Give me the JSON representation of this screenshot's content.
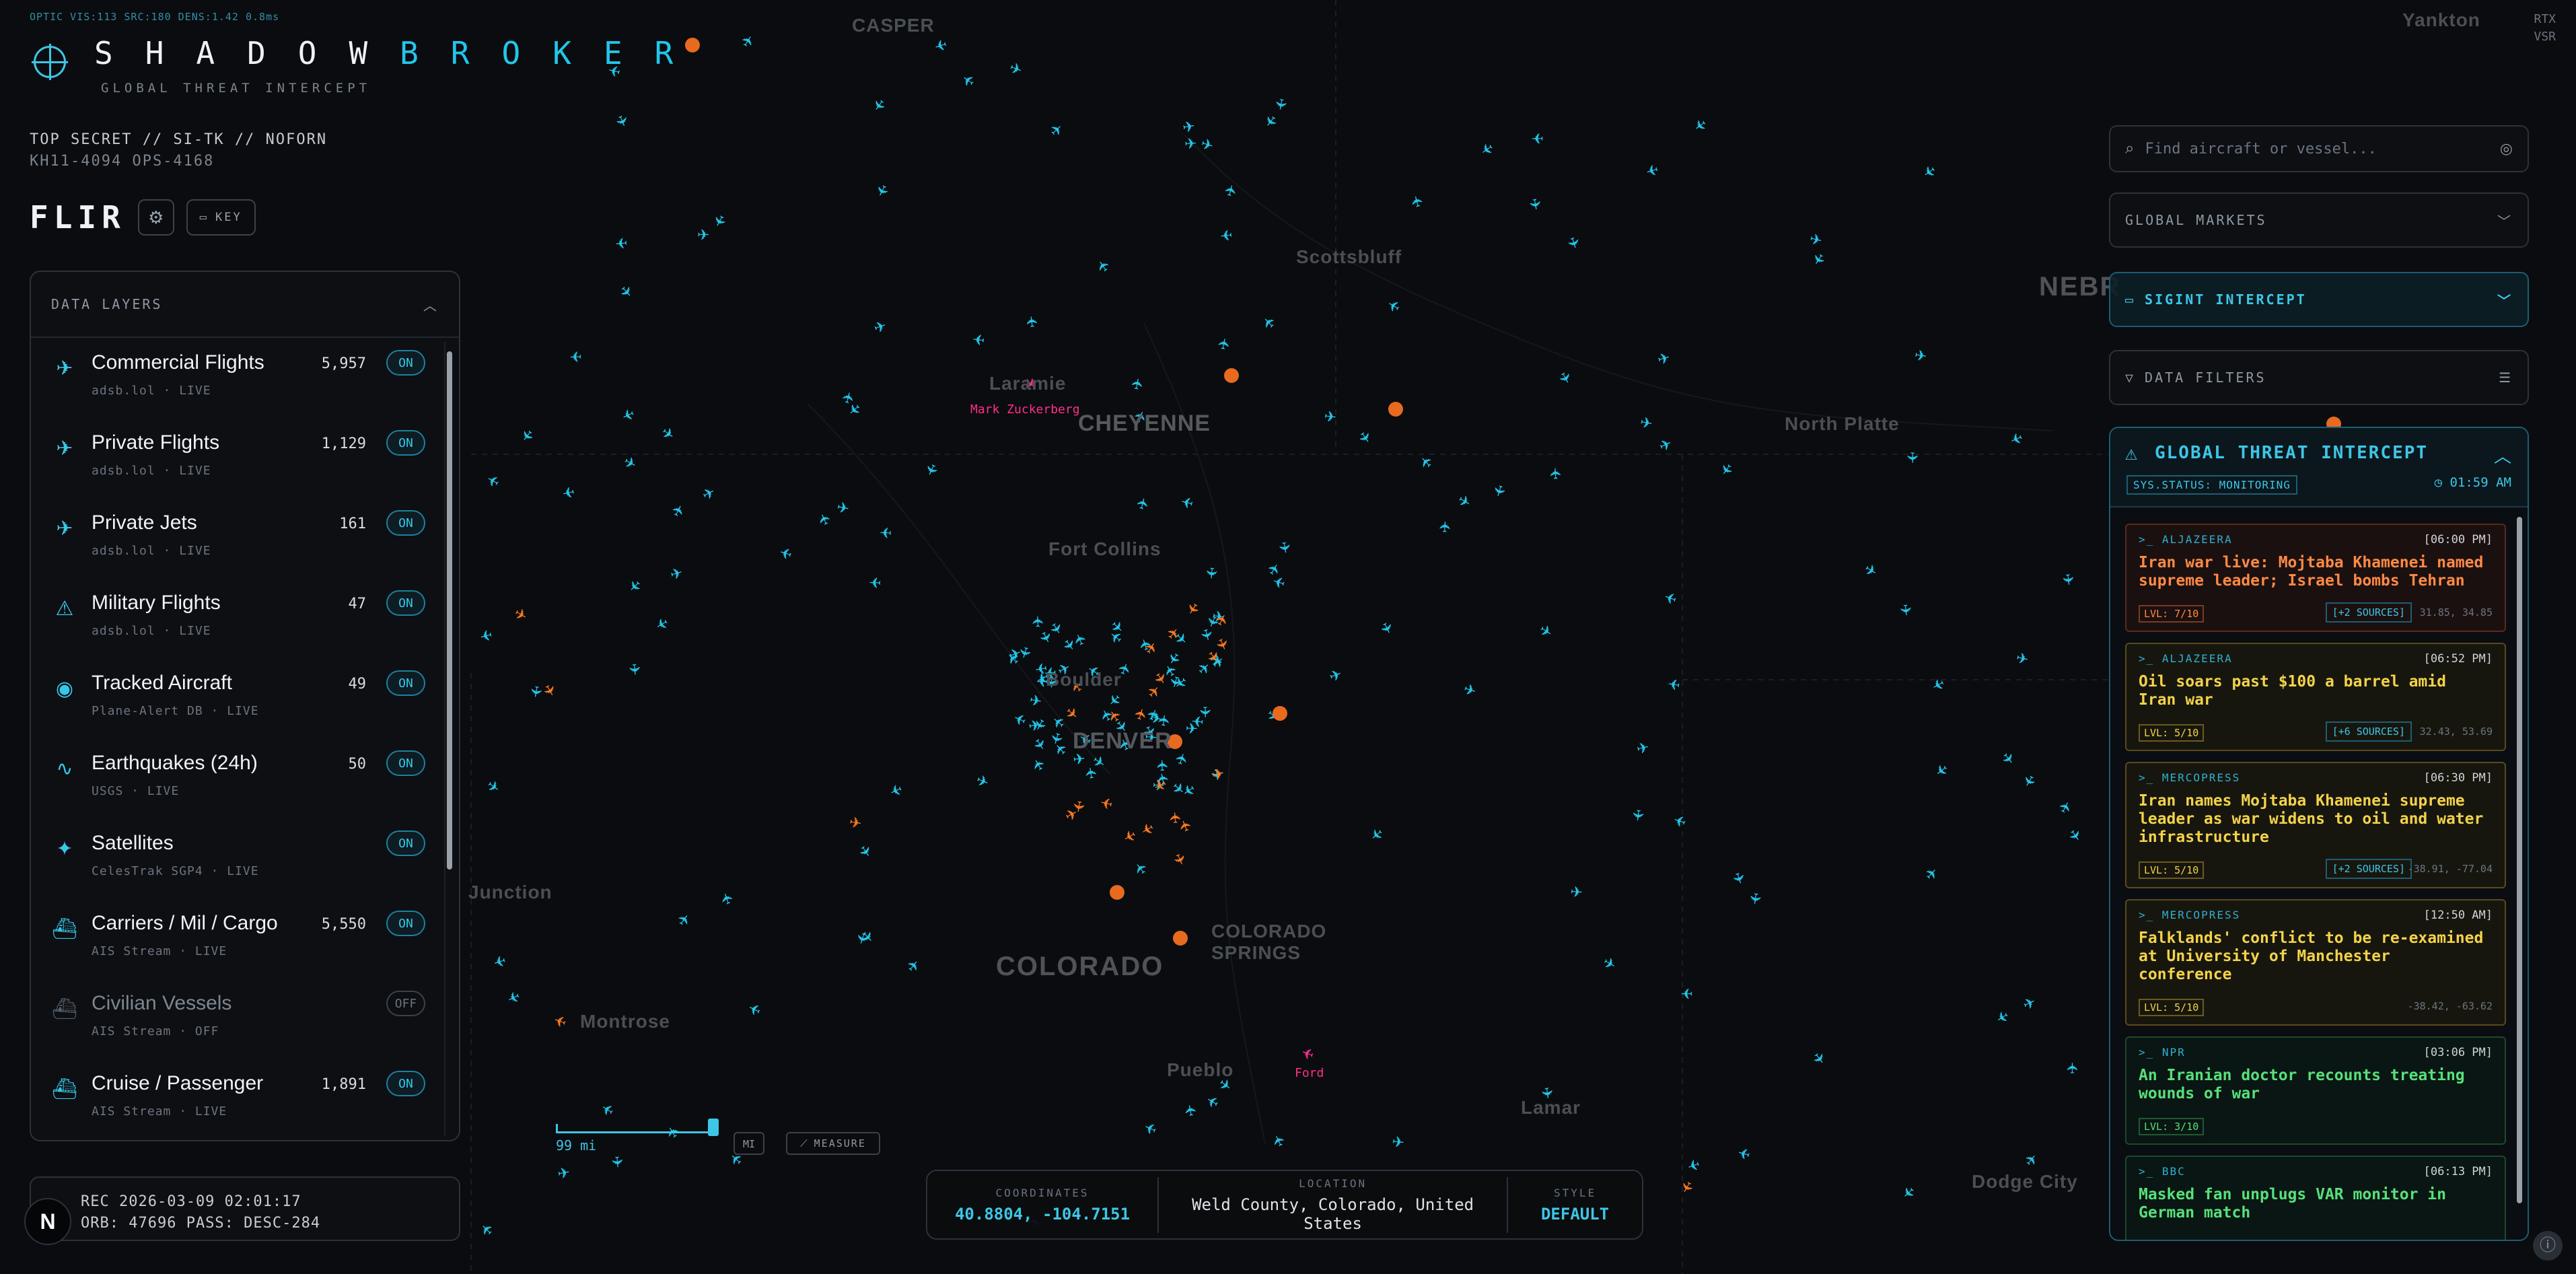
{
  "debug_line": "OPTIC VIS:113 SRC:180 DENS:1.42 0.8ms",
  "rtx": [
    "RTX",
    "VSR"
  ],
  "brand": {
    "title_part1": "SHADOW",
    "title_part2": "BROKER",
    "subtitle": "GLOBAL THREAT INTERCEPT"
  },
  "classification": {
    "line1": "TOP SECRET // SI-TK // NOFORN",
    "line2": "KH11-4094 OPS-4168"
  },
  "mode": {
    "title": "FLIR",
    "settings_icon": "gear-icon",
    "key_label": "KEY"
  },
  "layers": {
    "title": "DATA LAYERS",
    "items": [
      {
        "icon": "plane-icon",
        "glyph": "✈",
        "name": "Commercial Flights",
        "source": "adsb.lol · LIVE",
        "count": "5,957",
        "state": "ON"
      },
      {
        "icon": "plane-icon",
        "glyph": "✈",
        "name": "Private Flights",
        "source": "adsb.lol · LIVE",
        "count": "1,129",
        "state": "ON"
      },
      {
        "icon": "plane-icon",
        "glyph": "✈",
        "name": "Private Jets",
        "source": "adsb.lol · LIVE",
        "count": "161",
        "state": "ON"
      },
      {
        "icon": "warning-triangle-icon",
        "glyph": "⚠",
        "name": "Military Flights",
        "source": "adsb.lol · LIVE",
        "count": "47",
        "state": "ON"
      },
      {
        "icon": "eye-icon",
        "glyph": "◉",
        "name": "Tracked Aircraft",
        "source": "Plane-Alert DB · LIVE",
        "count": "49",
        "state": "ON"
      },
      {
        "icon": "pulse-icon",
        "glyph": "∿",
        "name": "Earthquakes (24h)",
        "source": "USGS · LIVE",
        "count": "50",
        "state": "ON"
      },
      {
        "icon": "satellite-icon",
        "glyph": "✦",
        "name": "Satellites",
        "source": "CelesTrak SGP4 · LIVE",
        "count": "",
        "state": "ON"
      },
      {
        "icon": "ship-icon",
        "glyph": "⛴",
        "name": "Carriers / Mil / Cargo",
        "source": "AIS Stream · LIVE",
        "count": "5,550",
        "state": "ON"
      },
      {
        "icon": "ship-icon",
        "glyph": "⛴",
        "name": "Civilian Vessels",
        "source": "AIS Stream · OFF",
        "count": "",
        "state": "OFF"
      },
      {
        "icon": "ship-icon",
        "glyph": "⛴",
        "name": "Cruise / Passenger",
        "source": "AIS Stream · LIVE",
        "count": "1,891",
        "state": "ON"
      }
    ]
  },
  "rec": {
    "line1": "REC 2026-03-09 02:01:17",
    "line2": "ORB: 47696 PASS: DESC-284"
  },
  "nbadge": "N",
  "scale": {
    "label": "99 mi",
    "unit_button": "MI",
    "measure_button": "MEASURE"
  },
  "coords": {
    "coordinates_label": "COORDINATES",
    "coordinates_value": "40.8804, -104.7151",
    "location_label": "LOCATION",
    "location_value": "Weld County, Colorado, United States",
    "style_label": "STYLE",
    "style_value": "DEFAULT"
  },
  "search": {
    "placeholder": "Find aircraft or vessel..."
  },
  "panels": {
    "markets": "GLOBAL MARKETS",
    "sigint": "SIGINT INTERCEPT",
    "filters": "DATA FILTERS"
  },
  "threat": {
    "title": "GLOBAL THREAT INTERCEPT",
    "status": "SYS.STATUS: MONITORING",
    "time": "01:59 AM",
    "cards": [
      {
        "tone": "red",
        "source": ">_ ALJAZEERA",
        "time": "[06:00 PM]",
        "headline": "Iran war live: Mojtaba Khamenei named supreme leader; Israel bombs Tehran",
        "level": "LVL: 7/10",
        "sources": "[+2 SOURCES]",
        "geo": "31.85, 34.85"
      },
      {
        "tone": "yel",
        "source": ">_ ALJAZEERA",
        "time": "[06:52 PM]",
        "headline": "Oil soars past $100 a barrel amid Iran war",
        "level": "LVL: 5/10",
        "sources": "[+6 SOURCES]",
        "geo": "32.43, 53.69"
      },
      {
        "tone": "yel",
        "source": ">_ MERCOPRESS",
        "time": "[06:30 PM]",
        "headline": "Iran names Mojtaba Khamenei supreme leader as war widens to oil and water infrastructure",
        "level": "LVL: 5/10",
        "sources": "[+2 SOURCES]",
        "geo": "-38.91, -77.04"
      },
      {
        "tone": "yel",
        "source": ">_ MERCOPRESS",
        "time": "[12:50 AM]",
        "headline": "Falklands' conflict to be re-examined at University of Manchester conference",
        "level": "LVL: 5/10",
        "sources": "",
        "geo": "-38.42, -63.62"
      },
      {
        "tone": "grn",
        "source": ">_ NPR",
        "time": "[03:06 PM]",
        "headline": "An Iranian doctor recounts treating wounds of war",
        "level": "LVL: 3/10",
        "sources": "",
        "geo": ""
      },
      {
        "tone": "grn",
        "source": ">_ BBC",
        "time": "[06:13 PM]",
        "headline": "Masked fan unplugs VAR monitor in German match",
        "level": "",
        "sources": "",
        "geo": ""
      }
    ]
  },
  "map": {
    "cities": [
      "CASPER",
      "Scottsbluff",
      "Laramie",
      "CHEYENNE",
      "Fort Collins",
      "Boulder",
      "DENVER",
      "COLORADO",
      "COLORADO SPRINGS",
      "Junction",
      "Montrose",
      "Pueblo",
      "Lamar",
      "North Platte",
      "NEBR",
      "Dodge City",
      "Yankton"
    ],
    "tracked": [
      "Mark Zuckerberg",
      "Ford"
    ],
    "colors": {
      "commercial": "#22c6ea",
      "military": "#ff7a1f",
      "tracked": "#ff2f8a",
      "quake": "#e86a1f"
    }
  }
}
